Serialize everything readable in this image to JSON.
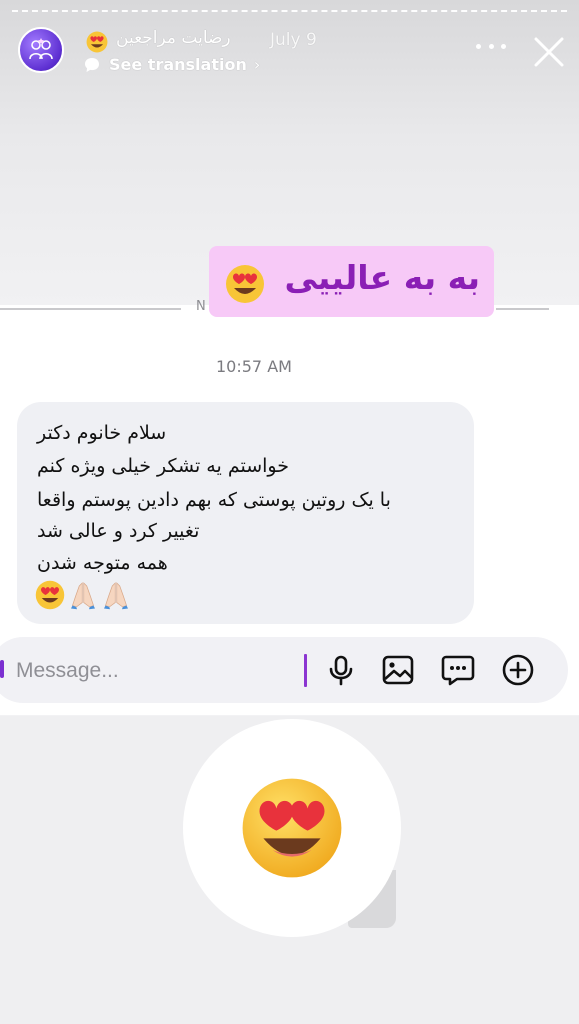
{
  "header": {
    "account_name": "رضایت مراجعین",
    "date": "July 9",
    "translation_label": "See translation",
    "icons": {
      "avatar": "people-logo-icon",
      "name_emoji": "heart-eyes-emoji-icon",
      "translate": "speech-bubble-icon",
      "more": "more-dots-icon",
      "close": "close-icon"
    }
  },
  "sticker": {
    "text": "به به عالییی",
    "emoji": "heart-eyes-emoji-icon",
    "background": "#f7c9f7",
    "text_color": "#8a1fb5"
  },
  "thread": {
    "divider_text": "N",
    "timestamp": "10:57 AM",
    "message_lines": [
      "سلام خانوم دکتر",
      "خواستم یه تشکر خیلی ویژه کنم",
      "با یک روتین پوستی که بهم دادین پوستم واقعا",
      "تغییر کرد و عالی شد",
      "همه متوجه شدن"
    ],
    "message_emojis": [
      "heart-eyes-emoji-icon",
      "folded-hands-icon",
      "folded-hands-icon"
    ]
  },
  "composer": {
    "placeholder": "Message...",
    "accent": "#8b35d1",
    "icons": [
      "microphone-icon",
      "gallery-icon",
      "sticker-chat-icon",
      "add-icon"
    ]
  },
  "reaction": {
    "emoji": "heart-eyes-emoji-icon"
  }
}
